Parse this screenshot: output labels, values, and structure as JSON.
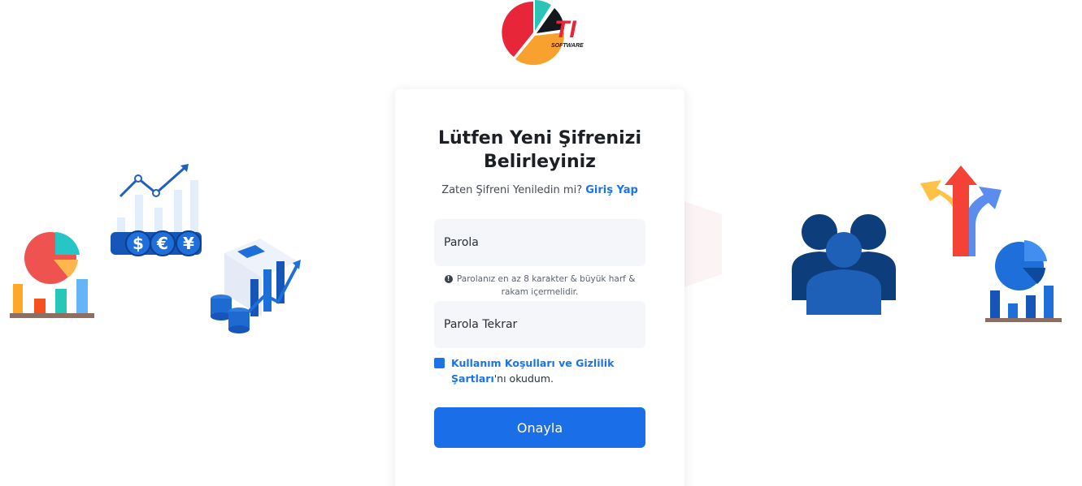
{
  "brand": {
    "logo_text": "TI",
    "logo_subtext": "SOFTWARE"
  },
  "form": {
    "title": "Lütfen Yeni Şifrenizi Belirleyiniz",
    "subtitle_prefix": "Zaten Şifreni Yeniledin mi?",
    "login_link": "Giriş Yap",
    "password_placeholder": "Parola",
    "password_hint": "Parolanız en az 8 karakter & büyük harf & rakam içermelidir.",
    "password_confirm_placeholder": "Parola Tekrar",
    "terms_link": "Kullanım Koşulları ve Gizlilik Şartları",
    "terms_suffix": "'nı okudum.",
    "submit_label": "Onayla"
  },
  "colors": {
    "primary": "#1a6fe8",
    "input_bg": "#f4f6f9"
  },
  "icons": {
    "hint": "info-icon",
    "currency": [
      "$",
      "€",
      "¥"
    ]
  }
}
